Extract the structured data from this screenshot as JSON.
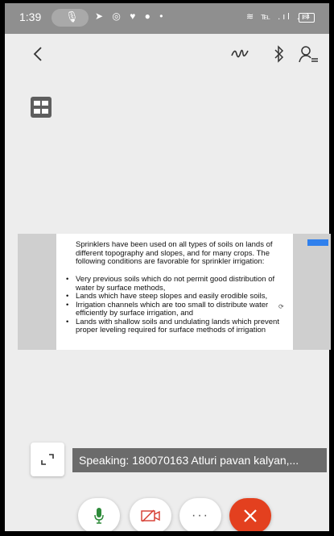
{
  "status_bar": {
    "time": "1:39",
    "battery": "84"
  },
  "toolbar": {
    "back_icon": "back-arrow-icon",
    "whiteboard_icon": "whiteboard-icon",
    "bluetooth_icon": "bluetooth-icon",
    "participants_icon": "participants-icon"
  },
  "slide": {
    "intro": "Sprinklers have been used on all types of soils on lands of different topography and slopes, and for many crops. The following conditions are favorable for sprinkler irrigation:",
    "bullets": [
      "Very previous soils which do not permit good distribution of water by surface methods,",
      "Lands which have steep slopes and easily erodible soils,",
      "Irrigation channels which are too small to distribute water efficiently by surface irrigation, and",
      "Lands with shallow soils and undulating lands which prevent proper leveling required for surface methods of irrigation"
    ]
  },
  "speaking_banner": "Speaking: 180070163 Atluri pavan kalyan,...",
  "call_controls": {
    "more_label": "···",
    "colors": {
      "mic": "#2e8b3a",
      "end_call": "#e3401f",
      "video_off": "#d63a2f"
    }
  }
}
